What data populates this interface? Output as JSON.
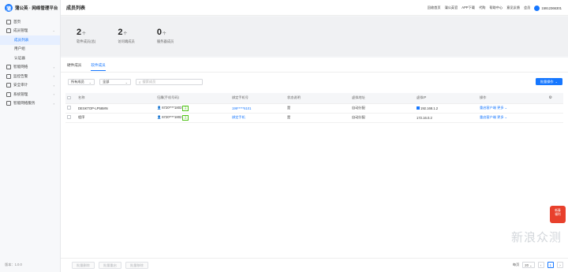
{
  "app": {
    "logo_text": "蒲公英 · 网络管理平台",
    "logo_glyph": "蒲"
  },
  "page_title": "成员列表",
  "top_links": [
    "回收首页",
    "蒲公英官",
    "APP下载",
    "代购",
    "帮助中心",
    "意见反馈",
    "会员"
  ],
  "user_name": "15912366301",
  "sidebar": {
    "items": [
      {
        "label": "首页",
        "icon": "home-icon"
      },
      {
        "label": "成员管理",
        "icon": "user-icon",
        "expanded": true,
        "children": [
          {
            "label": "成员列表",
            "active": true
          },
          {
            "label": "用户组"
          },
          {
            "label": "认证器"
          }
        ]
      },
      {
        "label": "智能网络",
        "icon": "network-icon"
      },
      {
        "label": "监控告警",
        "icon": "alarm-icon"
      },
      {
        "label": "安全审计",
        "icon": "shield-icon"
      },
      {
        "label": "系统管理",
        "icon": "settings-icon"
      },
      {
        "label": "智能网络服务",
        "icon": "service-icon"
      }
    ],
    "version": "版本：1.0.0"
  },
  "stats": [
    {
      "value": "2",
      "unit": "个",
      "label": "软件成员(总)"
    },
    {
      "value": "2",
      "unit": "个",
      "label": "访问端成员"
    },
    {
      "value": "0",
      "unit": "个",
      "label": "服务器成员"
    }
  ],
  "tabs": [
    "硬件成员",
    "软件成员"
  ],
  "filters": {
    "type": "所有成员",
    "status": "全部",
    "search_placeholder": "搜索成员"
  },
  "batch_button": "批量操作",
  "table": {
    "headers": [
      "",
      "名称",
      "归属(手机号码)",
      "绑定手机号",
      "状态说明",
      "虚拟地址",
      "虚拟IP",
      "操作"
    ],
    "rows": [
      {
        "name": "DESKTOP-LP56MN",
        "owner": "6720****1803",
        "owner_tag": "主",
        "phone": "199*****6101",
        "status": "是",
        "address": "自动分配",
        "ip": "192.168.1.2",
        "actions": [
          "重启客户端",
          "更多"
        ]
      },
      {
        "name": "程序",
        "owner": "6720****1802",
        "owner_tag": "主",
        "phone": "绑定手机",
        "status": "是",
        "address": "自动分配",
        "ip": "172.16.0.2",
        "actions": [
          "重启客户端",
          "更多"
        ]
      }
    ]
  },
  "footer": {
    "buttons": [
      "批量删除",
      "批量重启",
      "批量移除"
    ],
    "pager": {
      "label": "每页",
      "size": "20",
      "current": "1"
    }
  },
  "promo": "新春\n福利",
  "watermark": "新浪众测"
}
